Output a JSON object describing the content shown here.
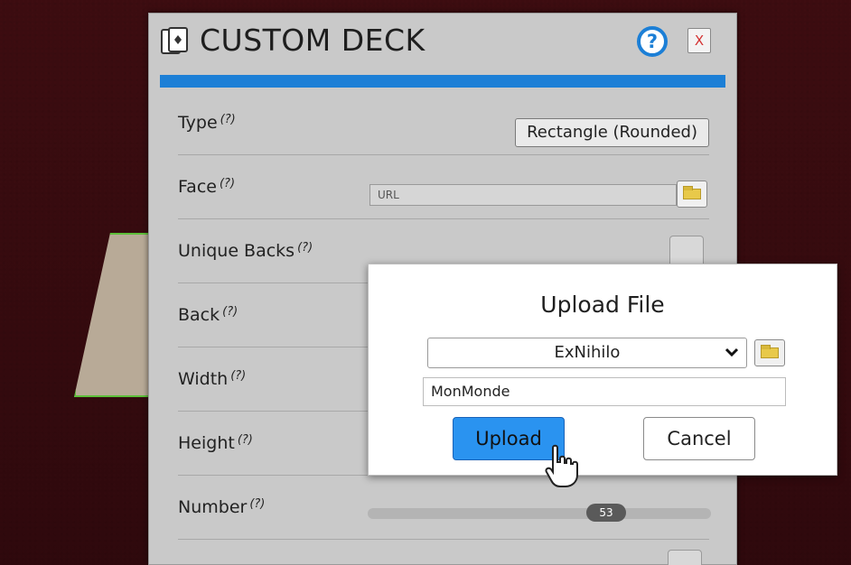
{
  "panel": {
    "title": "CUSTOM DECK",
    "help_label": "?",
    "close_label": "X"
  },
  "rows": {
    "type": {
      "label": "Type",
      "hint": "(?)",
      "value": "Rectangle (Rounded)"
    },
    "face": {
      "label": "Face",
      "hint": "(?)",
      "placeholder": "URL"
    },
    "unique_backs": {
      "label": "Unique Backs",
      "hint": "(?)"
    },
    "back": {
      "label": "Back",
      "hint": "(?)"
    },
    "width": {
      "label": "Width",
      "hint": "(?)"
    },
    "height": {
      "label": "Height",
      "hint": "(?)"
    },
    "number": {
      "label": "Number",
      "hint": "(?)",
      "value": "53"
    }
  },
  "dialog": {
    "title": "Upload File",
    "folder_selected": "ExNihilo",
    "file_name": "MonMonde",
    "upload_label": "Upload",
    "cancel_label": "Cancel"
  },
  "colors": {
    "accent": "#1c7fd6",
    "upload_button": "#2a93f0",
    "card_border": "#5dbf3a"
  }
}
